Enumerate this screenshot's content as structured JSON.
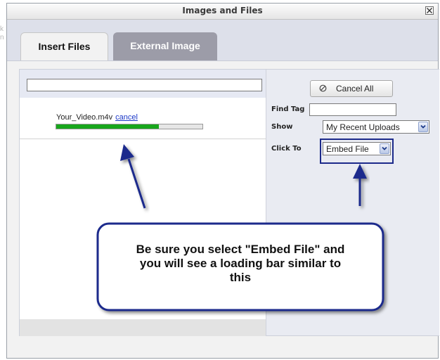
{
  "window": {
    "title": "Images and Files"
  },
  "tabs": [
    {
      "label": "Insert Files",
      "active": true
    },
    {
      "label": "External Image",
      "active": false
    }
  ],
  "upload": {
    "filename": "Your_Video.m4v",
    "cancel_label": "cancel",
    "progress": 0.7
  },
  "actions": {
    "cancel_all_label": "Cancel All"
  },
  "filters": {
    "find_tag_label": "Find Tag",
    "find_tag_value": "",
    "show_label": "Show",
    "show_value": "My Recent Uploads",
    "click_to_label": "Click To",
    "click_to_value": "Embed File"
  },
  "callout": {
    "lines": [
      "Be sure you select \"Embed File\" and",
      "you will see a loading bar similar to",
      "this"
    ]
  },
  "background": {
    "left_chars": [
      "k",
      "n"
    ]
  },
  "colors": {
    "arrow": "#1a2a8c",
    "progress_fill": "#18a61c",
    "tab_inactive": "#9c9ca8",
    "link": "#1a37c8"
  },
  "icons": {
    "close": "close-icon",
    "cancel_all": "cancel-circle-icon",
    "dropdown": "chevron-down-icon"
  }
}
